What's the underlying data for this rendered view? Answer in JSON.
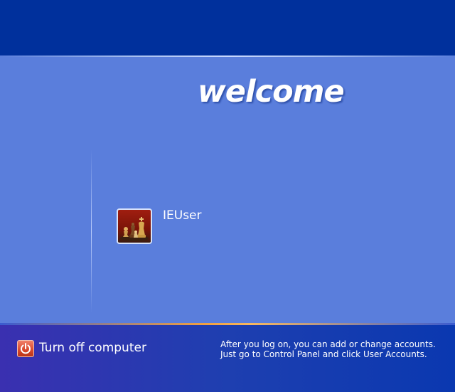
{
  "header": {
    "welcome_text": "welcome"
  },
  "users": [
    {
      "name": "IEUser",
      "avatar_icon": "chess-pieces-icon"
    }
  ],
  "footer": {
    "turn_off_label": "Turn off computer",
    "power_icon": "power-icon",
    "info_line_1": "After you log on, you can add or change accounts.",
    "info_line_2": "Just go to Control Panel and click User Accounts."
  },
  "colors": {
    "top_bar": "#00309c",
    "main_background": "#5a7edc",
    "accent_orange": "#f0a040",
    "power_red": "#d8482c"
  }
}
